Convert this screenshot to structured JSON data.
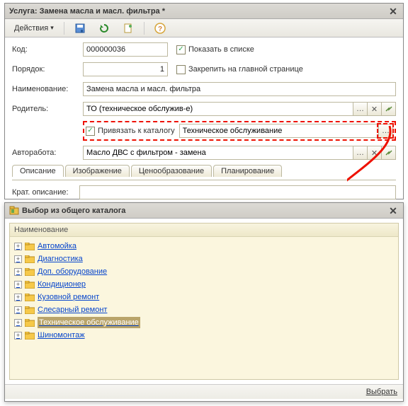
{
  "main": {
    "title": "Услуга: Замена масла и масл. фильтра *",
    "actions_label": "Действия",
    "labels": {
      "code": "Код:",
      "order": "Порядок:",
      "name": "Наименование:",
      "parent": "Родитель:",
      "autowork": "Авторабота:",
      "short_desc": "Крат. описание:"
    },
    "values": {
      "code": "000000036",
      "order": "1",
      "name": "Замена масла и масл. фильтра",
      "parent": "ТО (техническое обслужив-е)",
      "bind_catalog_value": "Техническое обслуживание",
      "autowork": "Масло ДВС с фильтром - замена",
      "short_desc": ""
    },
    "checks": {
      "show_in_list": {
        "label": "Показать в списке",
        "checked": true
      },
      "pin_main_page": {
        "label": "Закрепить на главной странице",
        "checked": false
      },
      "bind_catalog": {
        "label": "Привязать к каталогу",
        "checked": true
      }
    },
    "tabs": [
      "Описание",
      "Изображение",
      "Ценообразование",
      "Планирование"
    ]
  },
  "popup": {
    "title": "Выбор из общего каталога",
    "column": "Наименование",
    "items": [
      {
        "label": "Автомойка",
        "selected": false
      },
      {
        "label": "Диагностика",
        "selected": false
      },
      {
        "label": "Доп. оборудование",
        "selected": false
      },
      {
        "label": "Кондиционер",
        "selected": false
      },
      {
        "label": "Кузовной ремонт",
        "selected": false
      },
      {
        "label": "Слесарный ремонт",
        "selected": false
      },
      {
        "label": "Техническое обслуживание",
        "selected": true
      },
      {
        "label": "Шиномонтаж",
        "selected": false
      }
    ],
    "choose": "Выбрать"
  },
  "icons": {
    "ellipsis": "…"
  }
}
